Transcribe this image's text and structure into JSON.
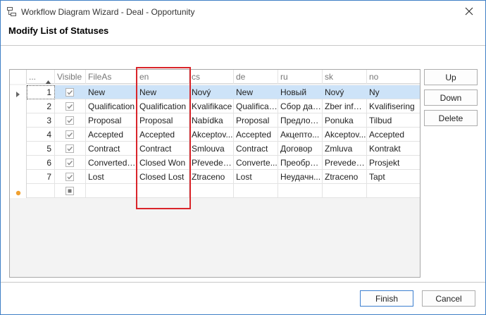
{
  "window": {
    "title": "Workflow Diagram Wizard - Deal - Opportunity"
  },
  "heading": "Modify List of Statuses",
  "grid": {
    "columns": {
      "order_header": "...",
      "visible": "Visible",
      "fileas": "FileAs",
      "en": "en",
      "cs": "cs",
      "de": "de",
      "ru": "ru",
      "sk": "sk",
      "no": "no"
    },
    "rows": [
      {
        "order": "1",
        "visible": true,
        "fileas": "New",
        "en": "New",
        "cs": "Nový",
        "de": "New",
        "ru": "Новый",
        "sk": "Nový",
        "no": "Ny"
      },
      {
        "order": "2",
        "visible": true,
        "fileas": "Qualification",
        "en": "Qualification",
        "cs": "Kvalifikace",
        "de": "Qualificati...",
        "ru": "Сбор дан...",
        "sk": "Zber infor...",
        "no": "Kvalifisering"
      },
      {
        "order": "3",
        "visible": true,
        "fileas": "Proposal",
        "en": "Proposal",
        "cs": "Nabídka",
        "de": "Proposal",
        "ru": "Предлож...",
        "sk": "Ponuka",
        "no": "Tilbud"
      },
      {
        "order": "4",
        "visible": true,
        "fileas": "Accepted",
        "en": "Accepted",
        "cs": "Akceptov...",
        "de": "Accepted",
        "ru": "Акцепто...",
        "sk": "Akceptov...",
        "no": "Accepted"
      },
      {
        "order": "5",
        "visible": true,
        "fileas": "Contract",
        "en": "Contract",
        "cs": "Smlouva",
        "de": "Contract",
        "ru": "Договор",
        "sk": "Zmluva",
        "no": "Kontrakt"
      },
      {
        "order": "6",
        "visible": true,
        "fileas": "Converted t...",
        "en": "Closed Won",
        "cs": "Převeden...",
        "de": "Converte...",
        "ru": "Преобраз...",
        "sk": "Preveden...",
        "no": "Prosjekt"
      },
      {
        "order": "7",
        "visible": true,
        "fileas": "Lost",
        "en": "Closed Lost",
        "cs": "Ztraceno",
        "de": "Lost",
        "ru": "Неудачн...",
        "sk": "Ztraceno",
        "no": "Tapt"
      }
    ]
  },
  "buttons": {
    "up": "Up",
    "down": "Down",
    "delete": "Delete",
    "finish": "Finish",
    "cancel": "Cancel"
  },
  "colors": {
    "accent": "#3c7fd0",
    "selection": "#cde3f8",
    "highlight": "#d9252a",
    "new_row_marker": "#f0a030"
  }
}
